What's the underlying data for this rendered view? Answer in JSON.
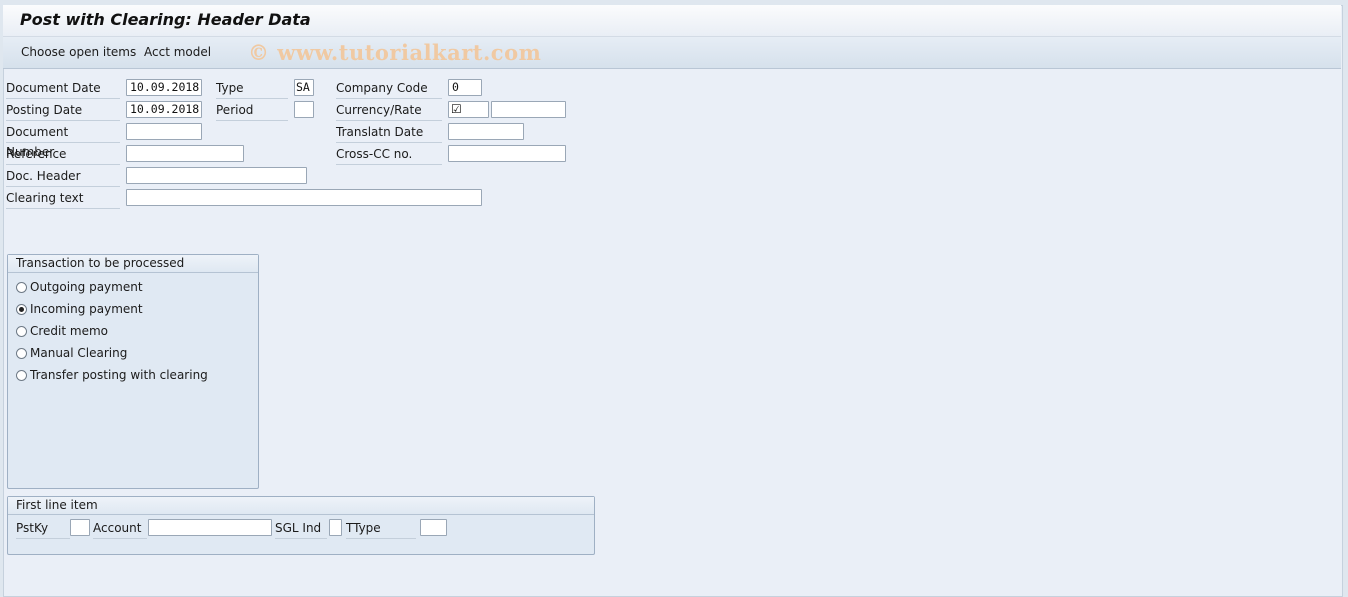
{
  "window": {
    "title": "Post with Clearing: Header Data"
  },
  "toolbar": {
    "choose_open_items": "Choose open items",
    "acct_model": "Acct model",
    "watermark": "© www.tutorialkart.com"
  },
  "header": {
    "document_date": {
      "label": "Document Date",
      "value": "10.09.2018"
    },
    "posting_date": {
      "label": "Posting Date",
      "value": "10.09.2018"
    },
    "document_number": {
      "label": "Document Number",
      "value": ""
    },
    "reference": {
      "label": "Reference",
      "value": ""
    },
    "doc_header": {
      "label": "Doc. Header",
      "value": ""
    },
    "clearing_text": {
      "label": "Clearing text",
      "value": ""
    },
    "type": {
      "label": "Type",
      "value": "SA"
    },
    "period": {
      "label": "Period",
      "value": ""
    },
    "company_code": {
      "label": "Company Code",
      "value": "0"
    },
    "currency_rate": {
      "label": "Currency/Rate",
      "checkbox": "☑",
      "rate_value": ""
    },
    "translation_date": {
      "label": "Translatn Date",
      "value": ""
    },
    "cross_cc": {
      "label": "Cross-CC no.",
      "value": ""
    }
  },
  "transaction_group": {
    "title": "Transaction to be processed",
    "options": [
      {
        "label": "Outgoing payment",
        "selected": false
      },
      {
        "label": "Incoming payment",
        "selected": true
      },
      {
        "label": "Credit memo",
        "selected": false
      },
      {
        "label": "Manual Clearing",
        "selected": false
      },
      {
        "label": "Transfer posting with clearing",
        "selected": false
      }
    ]
  },
  "first_line_item": {
    "title": "First line item",
    "pstky_label": "PstKy",
    "pstky_value": "",
    "account_label": "Account",
    "account_value": "",
    "sgl_ind_label": "SGL Ind",
    "sgl_ind_value": "",
    "ttype_label": "TType",
    "ttype_value": ""
  }
}
